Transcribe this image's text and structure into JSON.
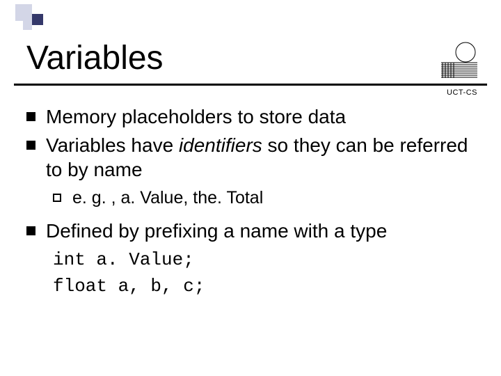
{
  "title": "Variables",
  "brand": "UCT-CS",
  "bullets": {
    "b1": "Memory placeholders to store data",
    "b2_pre": "Variables have ",
    "b2_em": "identifiers",
    "b2_post": " so they can be referred to by name",
    "sub1": "e. g. , a. Value, the. Total",
    "b3": "Defined by prefixing a name with a type"
  },
  "code": {
    "line1": "int a. Value;",
    "line2": "float a, b, c;"
  }
}
